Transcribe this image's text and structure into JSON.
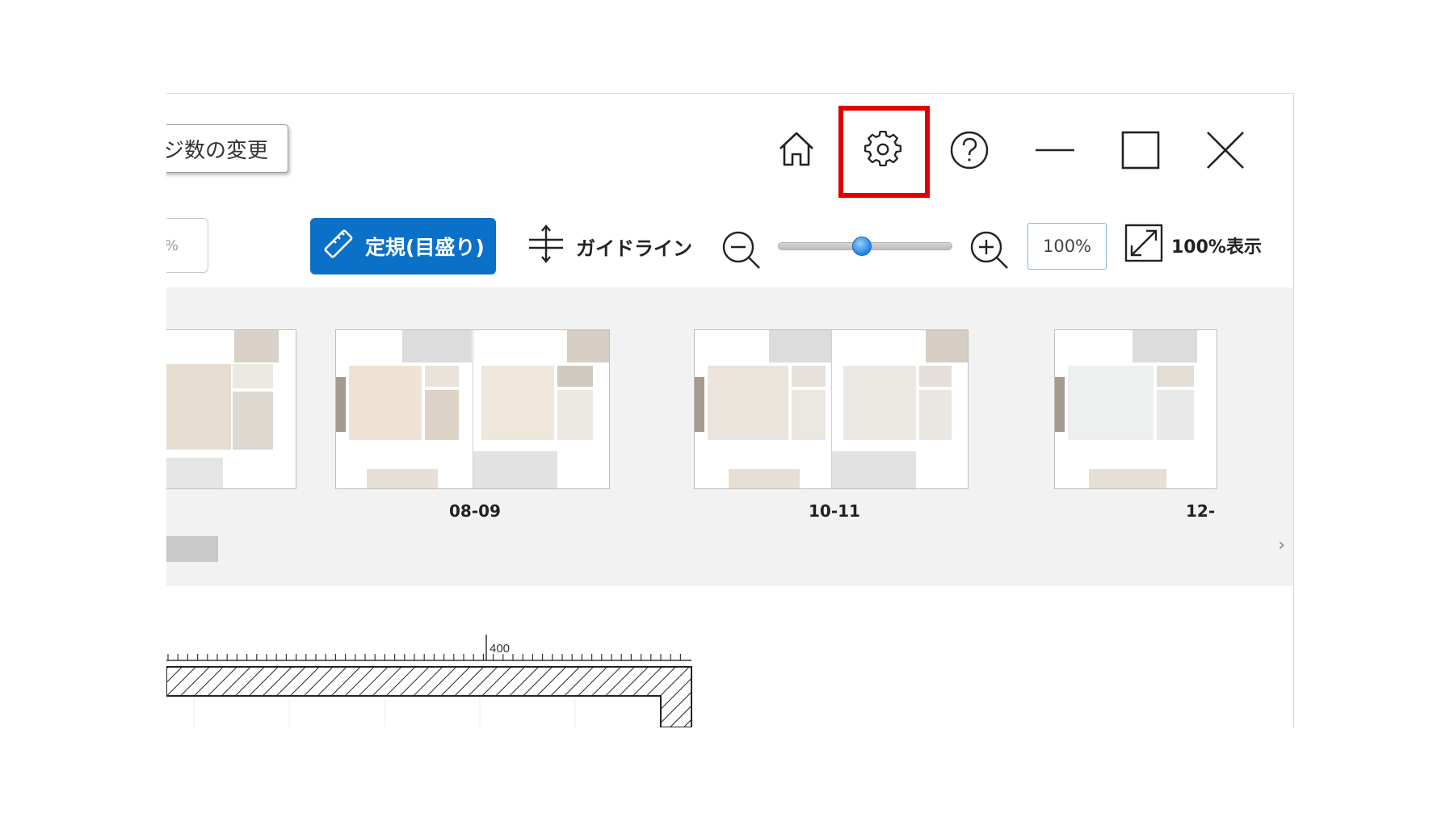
{
  "titlebar": {
    "page_change_button": "ジ数の変更",
    "home": "home-icon",
    "settings": "gear-icon",
    "help": "help-icon",
    "minimize": "minimize-icon",
    "maximize": "maximize-icon",
    "close": "close-icon",
    "highlight_color": "#e00000"
  },
  "toolbar": {
    "left_percent": "%",
    "ruler_label": "定規(目盛り)",
    "guide_label": "ガイドライン",
    "zoom_value": "100%",
    "zoom_slider_level": 0.48,
    "fit_label": "100%表示",
    "accent_color": "#0a70c8"
  },
  "strip": {
    "spreads": [
      {
        "label": ""
      },
      {
        "label": "08-09"
      },
      {
        "label": "10-11"
      },
      {
        "label": "12-"
      }
    ],
    "scroll_right": "›"
  },
  "canvas": {
    "ruler_label": "400"
  }
}
